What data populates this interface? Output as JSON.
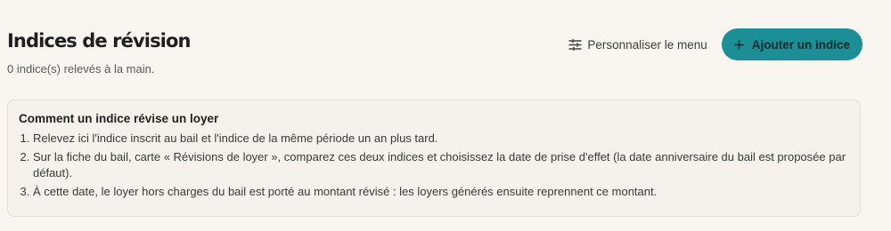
{
  "header": {
    "title": "Indices de révision",
    "subtitle": "0 indice(s) relevés à la main.",
    "customize_label": "Personnaliser le menu",
    "customize_icon": "sliders-icon",
    "add_label": "Ajouter un indice",
    "add_icon": "plus-icon"
  },
  "info": {
    "title": "Comment un indice révise un loyer",
    "steps": [
      "Relevez ici l'indice inscrit au bail et l'indice de la même période un an plus tard.",
      "Sur la fiche du bail, carte « Révisions de loyer », comparez ces deux indices et choisissez la date de prise d'effet (la date anniversaire du bail est proposée par défaut).",
      "À cette date, le loyer hors charges du bail est porté au montant révisé : les loyers générés ensuite reprennent ce montant."
    ]
  },
  "colors": {
    "accent": "#1c8e96",
    "background": "#f9f6f2",
    "info_background": "#f5f1ec",
    "info_border": "#e4ddd3"
  }
}
